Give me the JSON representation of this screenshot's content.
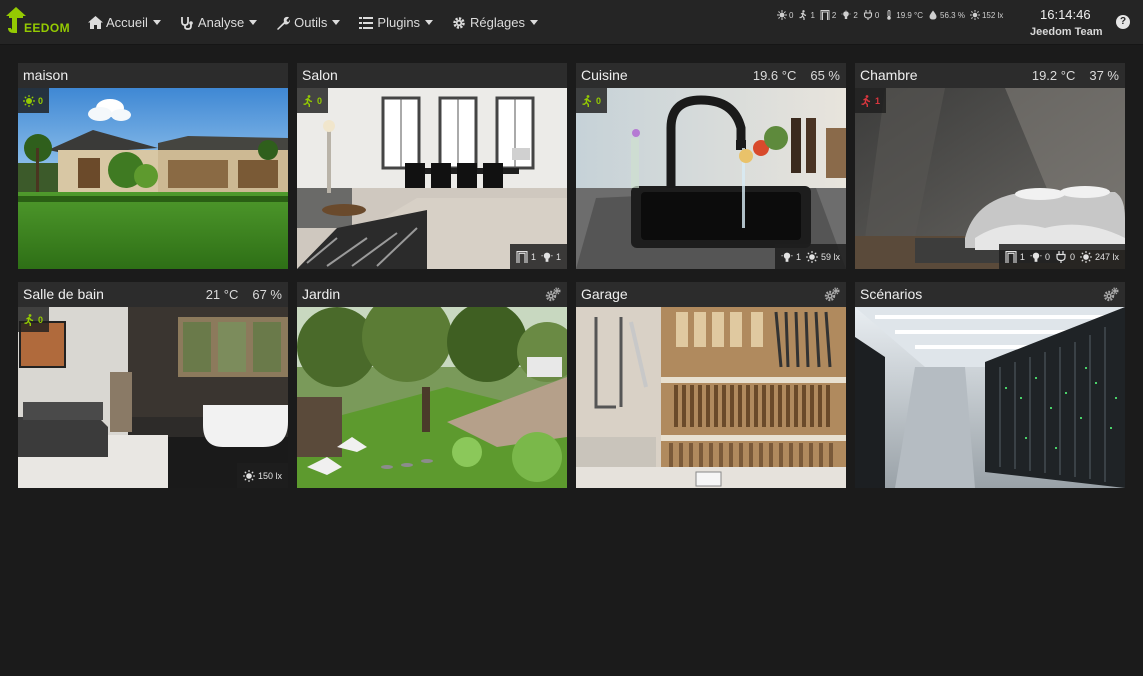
{
  "app": {
    "logo_text": "EEDOM",
    "accent": "#94ca02",
    "alert": "#d9363e"
  },
  "nav": {
    "items": [
      {
        "label": "Accueil",
        "icon": "home-icon"
      },
      {
        "label": "Analyse",
        "icon": "stethoscope-icon"
      },
      {
        "label": "Outils",
        "icon": "wrench-icon"
      },
      {
        "label": "Plugins",
        "icon": "list-icon"
      },
      {
        "label": "Réglages",
        "icon": "gear-icon"
      }
    ]
  },
  "summary": {
    "light": "0",
    "motion": "1",
    "door": "2",
    "outlet_light": "2",
    "plug": "0",
    "temperature": "19.9 °C",
    "humidity": "56.3 %",
    "luminosity": "152 lx"
  },
  "header": {
    "time": "16:14:46",
    "user": "Jeedom Team",
    "help": "?"
  },
  "cards": [
    {
      "name": "maison",
      "badge": {
        "icon": "light-icon",
        "value": "0",
        "color": "#94ca02"
      }
    },
    {
      "name": "Salon",
      "badge": {
        "icon": "motion-icon",
        "value": "0",
        "color": "#94ca02"
      },
      "footer": {
        "door": "1",
        "light": "1"
      }
    },
    {
      "name": "Cuisine",
      "temperature": "19.6 °C",
      "humidity": "65 %",
      "badge": {
        "icon": "motion-icon",
        "value": "0",
        "color": "#94ca02"
      },
      "footer": {
        "light": "1",
        "luminosity": "59 lx"
      }
    },
    {
      "name": "Chambre",
      "temperature": "19.2 °C",
      "humidity": "37 %",
      "badge": {
        "icon": "motion-icon",
        "value": "1",
        "color": "#d9363e"
      },
      "footer": {
        "door": "1",
        "light": "0",
        "plug": "0",
        "luminosity": "247 lx"
      }
    },
    {
      "name": "Salle de bain",
      "temperature": "21 °C",
      "humidity": "67 %",
      "badge": {
        "icon": "motion-icon",
        "value": "0",
        "color": "#94ca02"
      },
      "footer": {
        "luminosity": "150 lx"
      }
    },
    {
      "name": "Jardin",
      "action_icon": "gears-icon"
    },
    {
      "name": "Garage",
      "action_icon": "gears-icon"
    },
    {
      "name": "Scénarios",
      "action_icon": "gears-icon"
    }
  ]
}
